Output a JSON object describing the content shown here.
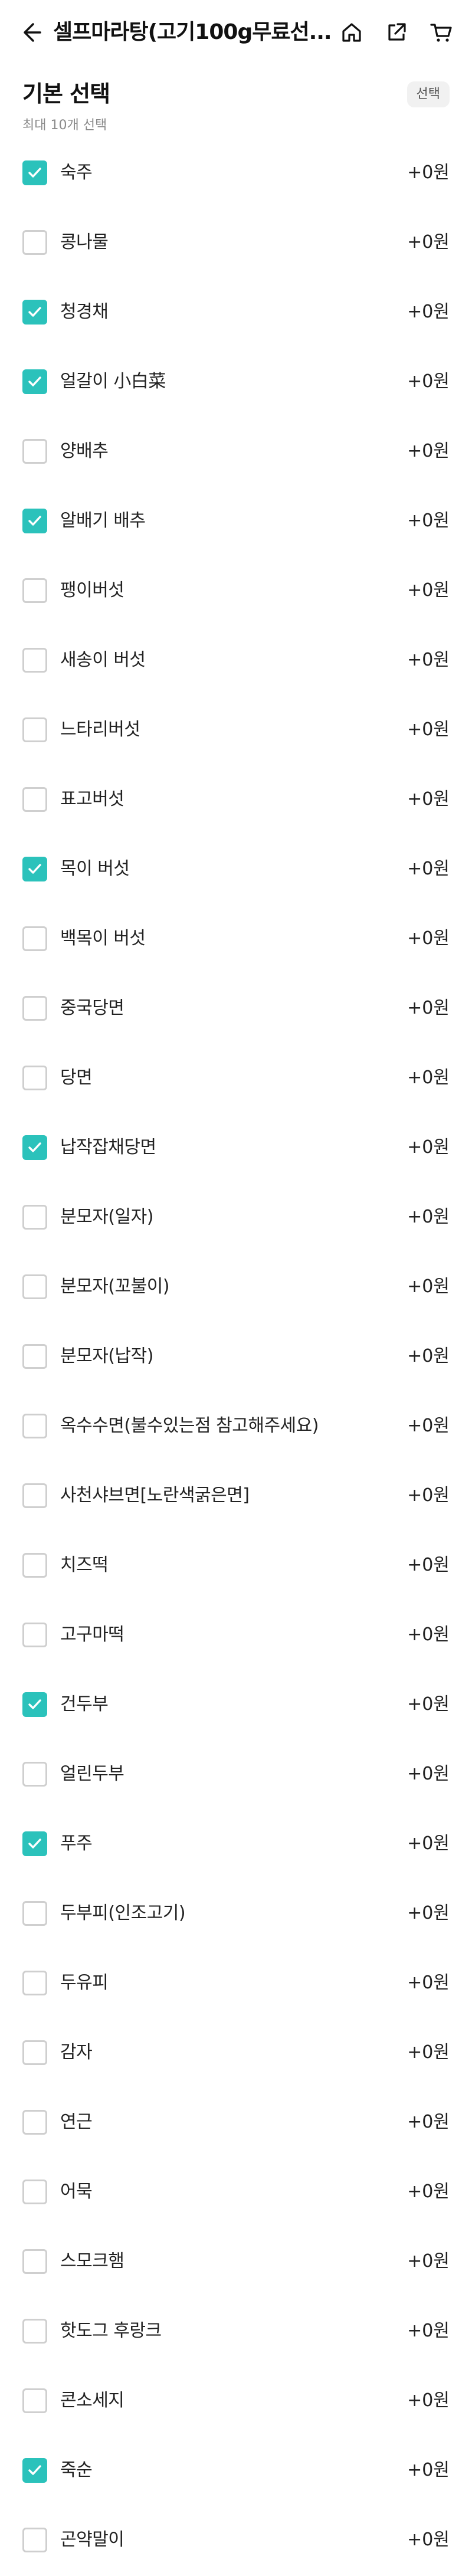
{
  "header": {
    "title": "셀프마라탕(고기100g무료선...",
    "icons": [
      "back-arrow-icon",
      "home-icon",
      "share-icon",
      "cart-icon"
    ]
  },
  "section": {
    "title": "기본 선택",
    "subtitle": "최대 10개 선택",
    "badge": "선택"
  },
  "accent_color": "#2bc2bb",
  "options": [
    {
      "label": "숙주",
      "price": "+0원",
      "checked": true
    },
    {
      "label": "콩나물",
      "price": "+0원",
      "checked": false
    },
    {
      "label": "청경채",
      "price": "+0원",
      "checked": true
    },
    {
      "label": "얼갈이 小白菜",
      "price": "+0원",
      "checked": true
    },
    {
      "label": "양배추",
      "price": "+0원",
      "checked": false
    },
    {
      "label": "알배기 배추",
      "price": "+0원",
      "checked": true
    },
    {
      "label": "팽이버섯",
      "price": "+0원",
      "checked": false
    },
    {
      "label": "새송이 버섯",
      "price": "+0원",
      "checked": false
    },
    {
      "label": "느타리버섯",
      "price": "+0원",
      "checked": false
    },
    {
      "label": "표고버섯",
      "price": "+0원",
      "checked": false
    },
    {
      "label": "목이 버섯",
      "price": "+0원",
      "checked": true
    },
    {
      "label": "백목이 버섯",
      "price": "+0원",
      "checked": false
    },
    {
      "label": "중국당면",
      "price": "+0원",
      "checked": false
    },
    {
      "label": "당면",
      "price": "+0원",
      "checked": false
    },
    {
      "label": "납작잡채당면",
      "price": "+0원",
      "checked": true
    },
    {
      "label": "분모자(일자)",
      "price": "+0원",
      "checked": false
    },
    {
      "label": "분모자(꼬불이)",
      "price": "+0원",
      "checked": false
    },
    {
      "label": "분모자(납작)",
      "price": "+0원",
      "checked": false
    },
    {
      "label": "옥수수면(불수있는점 참고해주세요)",
      "price": "+0원",
      "checked": false
    },
    {
      "label": "사천샤브면[노란색굵은면]",
      "price": "+0원",
      "checked": false
    },
    {
      "label": "치즈떡",
      "price": "+0원",
      "checked": false
    },
    {
      "label": "고구마떡",
      "price": "+0원",
      "checked": false
    },
    {
      "label": "건두부",
      "price": "+0원",
      "checked": true
    },
    {
      "label": "얼린두부",
      "price": "+0원",
      "checked": false
    },
    {
      "label": "푸주",
      "price": "+0원",
      "checked": true
    },
    {
      "label": "두부피(인조고기)",
      "price": "+0원",
      "checked": false
    },
    {
      "label": "두유피",
      "price": "+0원",
      "checked": false
    },
    {
      "label": "감자",
      "price": "+0원",
      "checked": false
    },
    {
      "label": "연근",
      "price": "+0원",
      "checked": false
    },
    {
      "label": "어묵",
      "price": "+0원",
      "checked": false
    },
    {
      "label": "스모크햄",
      "price": "+0원",
      "checked": false
    },
    {
      "label": "핫도그 후랑크",
      "price": "+0원",
      "checked": false
    },
    {
      "label": "콘소세지",
      "price": "+0원",
      "checked": false
    },
    {
      "label": "죽순",
      "price": "+0원",
      "checked": true
    },
    {
      "label": "곤약말이",
      "price": "+0원",
      "checked": false
    }
  ]
}
